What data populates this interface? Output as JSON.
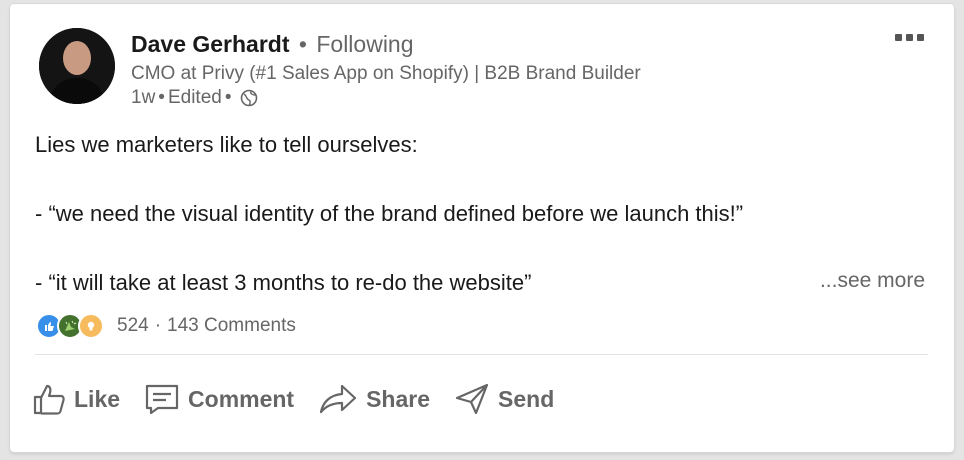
{
  "post": {
    "author": {
      "name": "Dave Gerhardt",
      "separator": "•",
      "follow_status": "Following",
      "headline": "CMO at Privy (#1 Sales App on Shopify) | B2B Brand Builder",
      "time": "1w",
      "edited": "Edited",
      "visibility_icon": "globe-icon"
    },
    "more_icon": "more-horizontal-icon",
    "body": {
      "line1": "Lies we marketers like to tell ourselves:",
      "line2": "- “we need the visual identity of the brand defined before we launch this!”",
      "line3": "- “it will take at least 3 months to re-do the website”"
    },
    "see_more": "...see more",
    "social": {
      "reaction_icons": [
        "like-icon",
        "celebrate-icon",
        "insightful-icon"
      ],
      "reaction_count": "524",
      "separator": "·",
      "comments": "143 Comments"
    },
    "actions": [
      {
        "label": "Like",
        "icon": "thumbs-up-icon"
      },
      {
        "label": "Comment",
        "icon": "comment-icon"
      },
      {
        "label": "Share",
        "icon": "share-arrow-icon"
      },
      {
        "label": "Send",
        "icon": "send-icon"
      }
    ]
  },
  "colors": {
    "like_blue": "#378fe9",
    "celebrate_green": "#44712e",
    "insightful_yellow": "#e7a33e",
    "muted_text": "#666666"
  }
}
